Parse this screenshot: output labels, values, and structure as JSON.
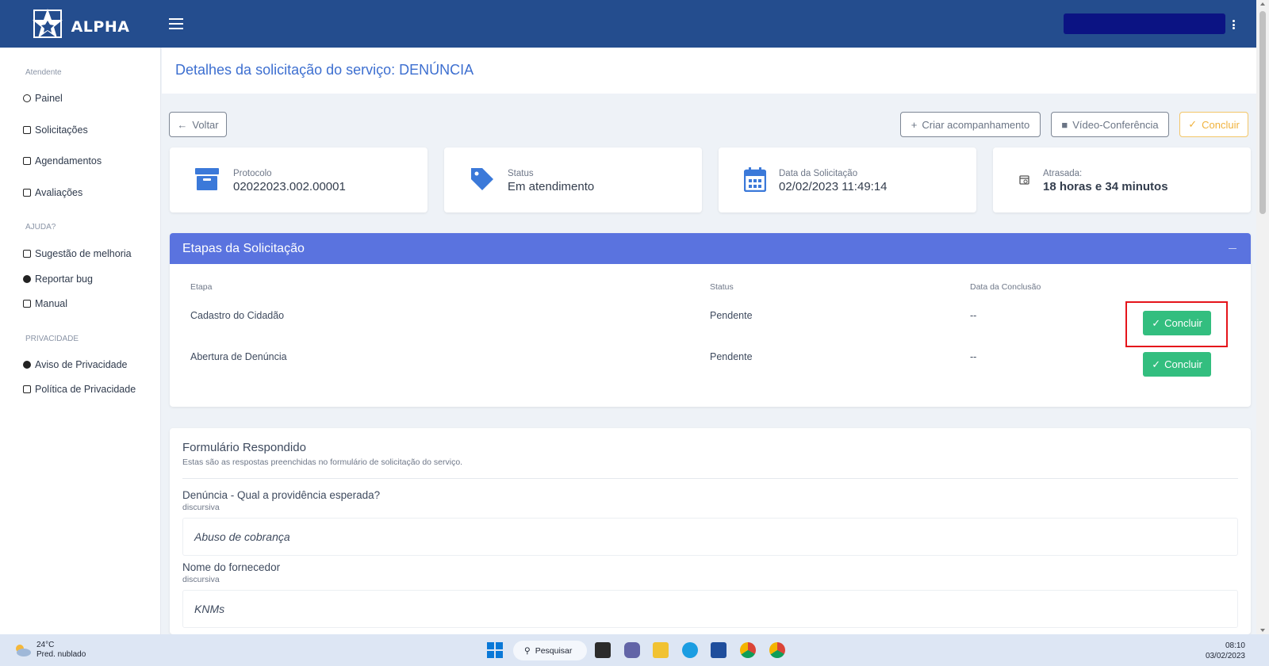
{
  "brand": {
    "name": "ALPHA"
  },
  "sidebar": {
    "section_atendente": "Atendente",
    "item_painel": "Painel",
    "item_solicitacoes": "Solicitações",
    "item_agendamentos": "Agendamentos",
    "item_avaliacoes": "Avaliações",
    "section_ajuda": "AJUDA?",
    "item_sugestao": "Sugestão de melhoria",
    "item_bug": "Reportar bug",
    "item_manual": "Manual",
    "section_privacidade": "PRIVACIDADE",
    "item_aviso": "Aviso de Privacidade",
    "item_politica": "Política de Privacidade"
  },
  "page": {
    "title": "Detalhes da solicitação do serviço: DENÚNCIA"
  },
  "actions": {
    "back": "Voltar",
    "create_follow": "Criar acompanhamento",
    "video_conf": "Vídeo-Conferência",
    "conclude": "Concluir"
  },
  "cards": {
    "protocol_label": "Protocolo",
    "protocol_value": "02022023.002.00001",
    "status_label": "Status",
    "status_value": "Em atendimento",
    "date_label": "Data da Solicitação",
    "date_value": "02/02/2023 11:49:14",
    "late_label": "Atrasada:",
    "late_value": "18 horas e 34 minutos"
  },
  "steps": {
    "title": "Etapas da Solicitação",
    "col_etapa": "Etapa",
    "col_status": "Status",
    "col_date": "Data da Conclusão",
    "rows": [
      {
        "name": "Cadastro do Cidadão",
        "status": "Pendente",
        "date": "--",
        "action": "Concluir"
      },
      {
        "name": "Abertura de Denúncia",
        "status": "Pendente",
        "date": "--",
        "action": "Concluir"
      }
    ]
  },
  "form": {
    "title": "Formulário Respondido",
    "subtitle": "Estas são as respostas preenchidas no formulário de solicitação do serviço.",
    "questions": [
      {
        "label": "Denúncia - Qual a providência esperada?",
        "type": "discursiva",
        "answer": "Abuso de cobrança"
      },
      {
        "label": "Nome do fornecedor",
        "type": "discursiva",
        "answer": "KNMs"
      }
    ]
  },
  "taskbar": {
    "temperature": "24°C",
    "weather": "Pred. nublado",
    "search": "Pesquisar",
    "time": "08:10",
    "date": "03/02/2023"
  },
  "colors": {
    "topbar": "#244d8e",
    "accent": "#5a73df",
    "success": "#33be7f",
    "warning": "#f0b23c",
    "highlight": "#e5141b"
  }
}
